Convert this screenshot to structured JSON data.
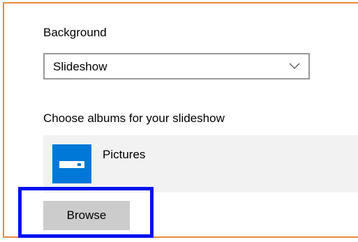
{
  "background": {
    "label": "Background",
    "select": {
      "value": "Slideshow",
      "chevron_icon": "chevron-down-icon"
    }
  },
  "albums": {
    "label": "Choose albums for your slideshow",
    "items": [
      {
        "name": "Pictures",
        "icon": "pictures-folder-icon"
      }
    ]
  },
  "browse_button": {
    "label": "Browse"
  },
  "colors": {
    "frame_border": "#e8893a",
    "highlight_border": "#0011ee",
    "album_icon_bg": "#0078d7",
    "album_row_bg": "#f2f2f2",
    "button_bg": "#cccccc"
  }
}
